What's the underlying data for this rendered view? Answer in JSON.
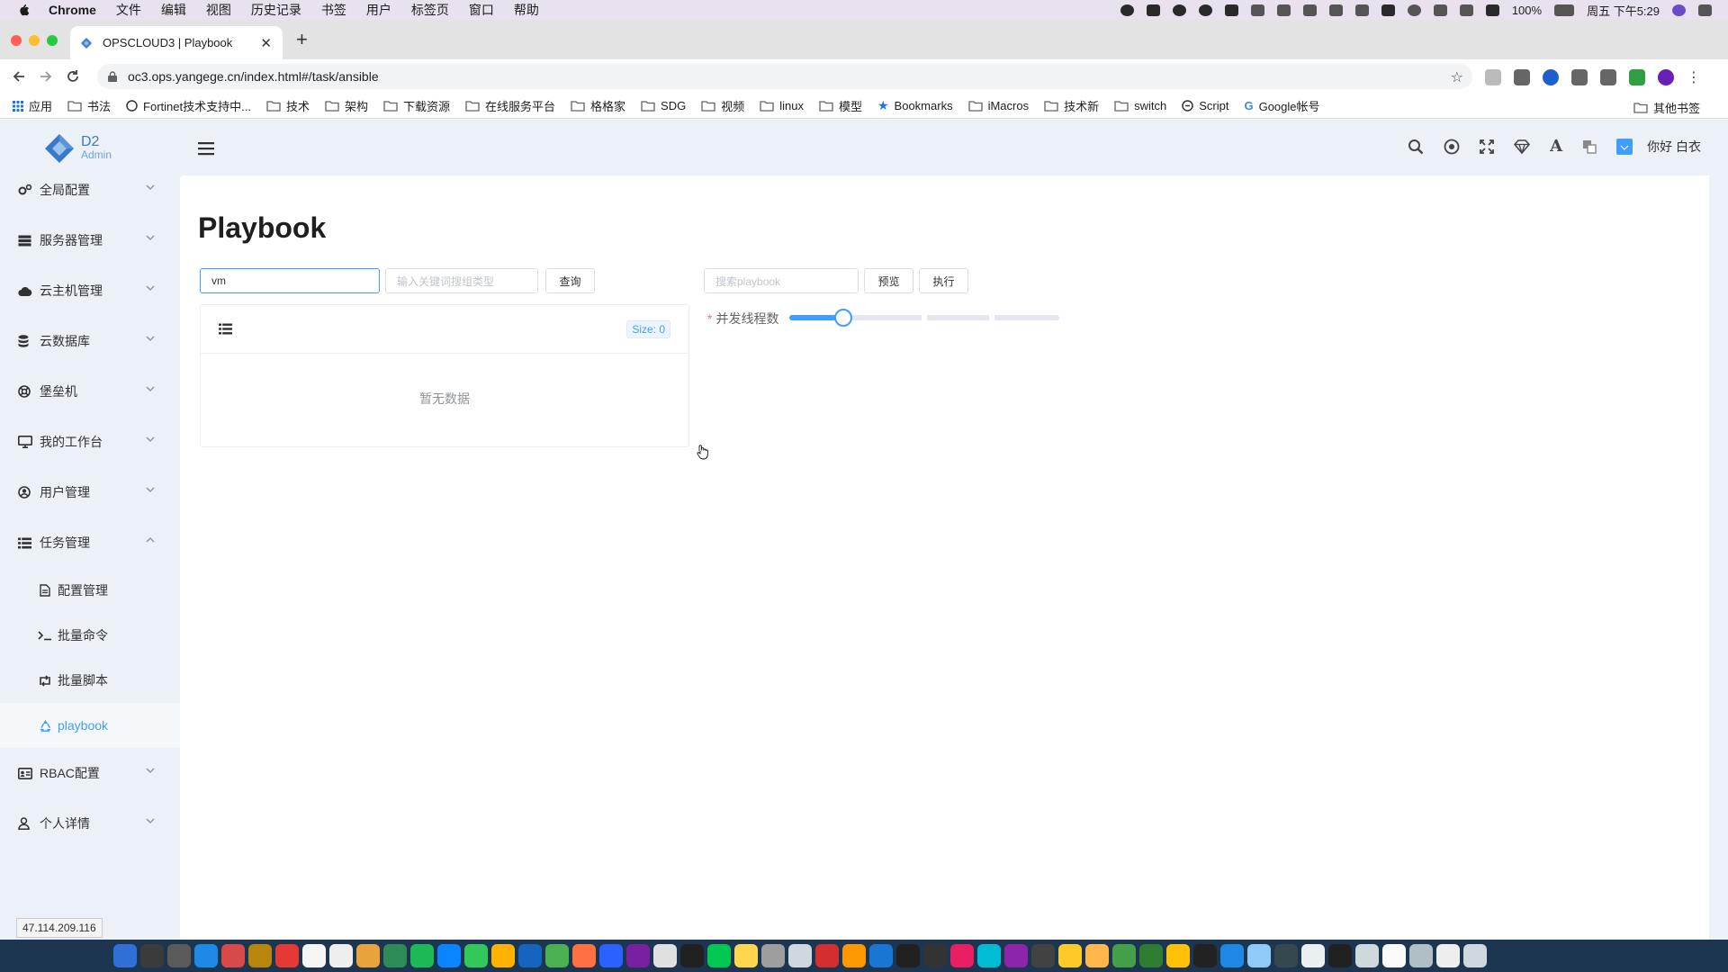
{
  "mac_menubar": {
    "app_name": "Chrome",
    "items": [
      "文件",
      "编辑",
      "视图",
      "历史记录",
      "书签",
      "用户",
      "标签页",
      "窗口",
      "帮助"
    ],
    "battery": "100%",
    "clock": "周五 下午5:29"
  },
  "browser": {
    "tab_title": "OPSCLOUD3 | Playbook",
    "url": "oc3.ops.yangege.cn/index.html#/task/ansible",
    "bookmarks": [
      {
        "label": "应用",
        "icon": "apps-grid-icon"
      },
      {
        "label": "书法",
        "icon": "folder-icon"
      },
      {
        "label": "Fortinet技术支持中...",
        "icon": "fortinet-icon"
      },
      {
        "label": "技术",
        "icon": "folder-icon"
      },
      {
        "label": "架构",
        "icon": "folder-icon"
      },
      {
        "label": "下载资源",
        "icon": "folder-icon"
      },
      {
        "label": "在线服务平台",
        "icon": "folder-icon"
      },
      {
        "label": "格格家",
        "icon": "folder-icon"
      },
      {
        "label": "SDG",
        "icon": "folder-icon"
      },
      {
        "label": "视频",
        "icon": "folder-icon"
      },
      {
        "label": "linux",
        "icon": "folder-icon"
      },
      {
        "label": "模型",
        "icon": "folder-icon"
      },
      {
        "label": "Bookmarks",
        "icon": "star-icon"
      },
      {
        "label": "iMacros",
        "icon": "folder-icon"
      },
      {
        "label": "技术新",
        "icon": "folder-icon"
      },
      {
        "label": "switch",
        "icon": "folder-icon"
      },
      {
        "label": "Script",
        "icon": "script-icon"
      },
      {
        "label": "Google帐号",
        "icon": "google-icon"
      }
    ],
    "other_bookmarks": "其他书签"
  },
  "app": {
    "logo": {
      "line1": "D2",
      "line2": "Admin"
    },
    "greeting": "你好 白衣",
    "ip": "47.114.209.116",
    "menu": [
      {
        "label": "全局配置",
        "icon": "gears-icon"
      },
      {
        "label": "服务器管理",
        "icon": "server-icon"
      },
      {
        "label": "云主机管理",
        "icon": "cloud-icon"
      },
      {
        "label": "云数据库",
        "icon": "database-icon"
      },
      {
        "label": "堡垒机",
        "icon": "life-ring-icon"
      },
      {
        "label": "我的工作台",
        "icon": "desktop-icon"
      },
      {
        "label": "用户管理",
        "icon": "user-circle-icon"
      },
      {
        "label": "任务管理",
        "icon": "list-icon"
      },
      {
        "label": "RBAC配置",
        "icon": "id-card-icon"
      },
      {
        "label": "个人详情",
        "icon": "user-icon"
      }
    ],
    "task_submenu": [
      {
        "label": "配置管理",
        "icon": "file-icon"
      },
      {
        "label": "批量命令",
        "icon": "terminal-icon"
      },
      {
        "label": "批量脚本",
        "icon": "retweet-icon"
      },
      {
        "label": "playbook",
        "icon": "recycle-icon"
      }
    ],
    "page": {
      "title": "Playbook",
      "group_input_value": "vm",
      "keyword_placeholder": "输入关键词搜组类型",
      "query_button": "查询",
      "size_tag": "Size: 0",
      "empty_text": "暂无数据",
      "playbook_placeholder": "搜索playbook",
      "preview_button": "预览",
      "execute_button": "执行",
      "thread_label": "并发线程数",
      "thread_slider_fraction": 0.2,
      "required_mark": "*"
    }
  },
  "colors": {
    "primary": "#409eff",
    "sidebar_bg": "#ebf1f6",
    "danger": "#f56c6c"
  }
}
